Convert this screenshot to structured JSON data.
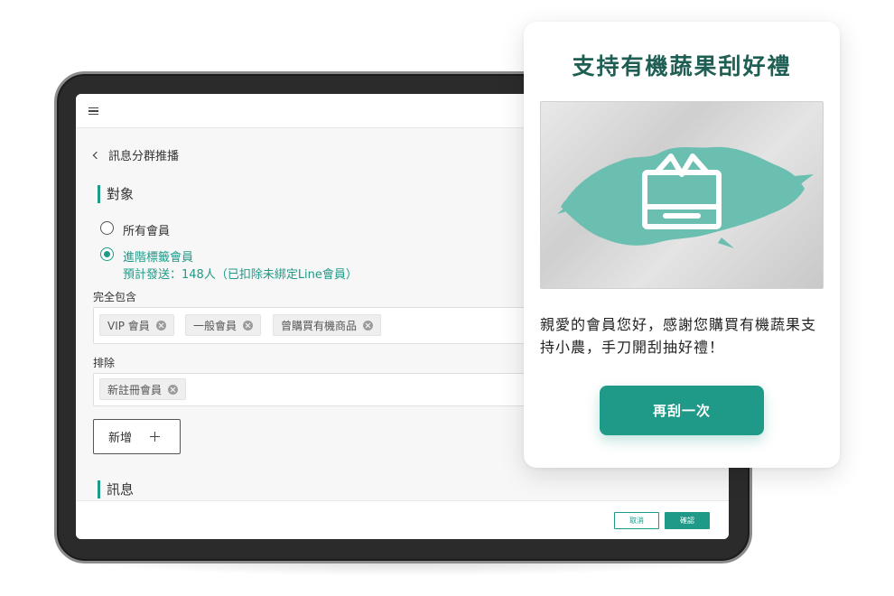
{
  "broadcast": {
    "back_label": "訊息分群推播",
    "audience": {
      "heading": "對象",
      "option_all": "所有會員",
      "option_tagged": "進階標籤會員",
      "estimate": "預計發送：148人（已扣除未綁定Line會員）"
    },
    "include": {
      "label": "完全包含",
      "tags": [
        "VIP 會員",
        "一般會員",
        "曾購買有機商品"
      ]
    },
    "exclude": {
      "label": "排除",
      "tags": [
        "新註冊會員"
      ]
    },
    "add_button": "新增",
    "message_heading": "訊息",
    "footer": {
      "cancel": "取消",
      "confirm": "確認"
    }
  },
  "popup": {
    "title": "支持有機蔬果刮好禮",
    "message": "親愛的會員您好，感謝您購買有機蔬果支持小農，手刀開刮抽好禮！",
    "retry_button": "再刮一次",
    "accent_color": "#1f9a88",
    "scratch_color": "#6bbfb1",
    "icon": "gift-icon"
  }
}
